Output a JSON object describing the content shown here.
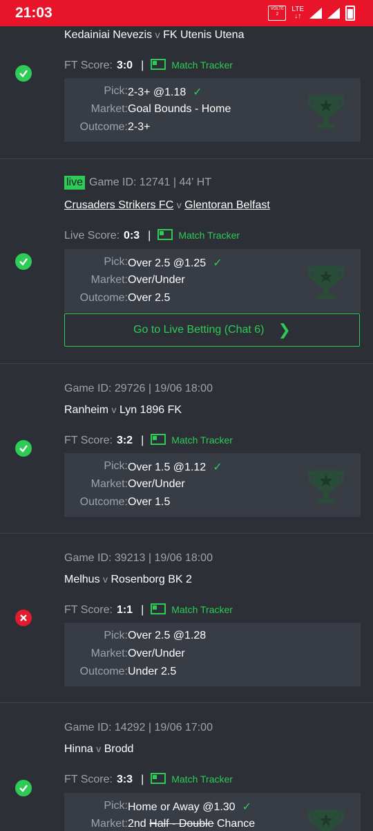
{
  "status_bar": {
    "time": "21:03",
    "volte": "VOLTE",
    "sim": "2",
    "network": "LTE"
  },
  "labels": {
    "pick": "Pick:",
    "market": "Market:",
    "outcome": "Outcome:",
    "match_tracker": "Match Tracker",
    "sep": "|",
    "v": "v"
  },
  "matches": [
    {
      "result": "win",
      "home": "Kedainiai Nevezis",
      "away": "FK Utenis Utena",
      "score_label": "FT Score:",
      "score": "3:0",
      "pick": "2-3+ @1.18",
      "market": "Goal Bounds - Home",
      "outcome": "2-3+"
    },
    {
      "result": "win",
      "live": "live",
      "meta": "Game ID: 12741 | 44' HT",
      "home": "Crusaders Strikers FC",
      "away": "Glentoran Belfast",
      "score_label": "Live Score:",
      "score": "0:3",
      "pick": "Over 2.5 @1.25",
      "market": "Over/Under",
      "outcome": "Over 2.5",
      "live_button": "Go to Live Betting (Chat 6)"
    },
    {
      "result": "win",
      "meta": "Game ID: 29726 | 19/06 18:00",
      "home": "Ranheim",
      "away": "Lyn 1896 FK",
      "score_label": "FT Score:",
      "score": "3:2",
      "pick": "Over 1.5 @1.12",
      "market": "Over/Under",
      "outcome": "Over 1.5"
    },
    {
      "result": "loss",
      "meta": "Game ID: 39213 | 19/06 18:00",
      "home": "Melhus",
      "away": "Rosenborg BK 2",
      "score_label": "FT Score:",
      "score": "1:1",
      "pick": "Over 2.5 @1.28",
      "market": "Over/Under",
      "outcome": "Under 2.5"
    },
    {
      "result": "win",
      "meta": "Game ID: 14292 | 19/06 17:00",
      "home": "Hinna",
      "away": "Brodd",
      "score_label": "FT Score:",
      "score": "3:3",
      "pick": "Home or Away @1.30",
      "market_a": "2nd ",
      "market_b": "Half - Double",
      "market_c": " Chance"
    }
  ],
  "colors": {
    "accent_green": "#2ecc56",
    "loss_red": "#e21b2f",
    "status_red": "#e8142a",
    "bg": "#2c2f36",
    "box": "#383c44"
  }
}
